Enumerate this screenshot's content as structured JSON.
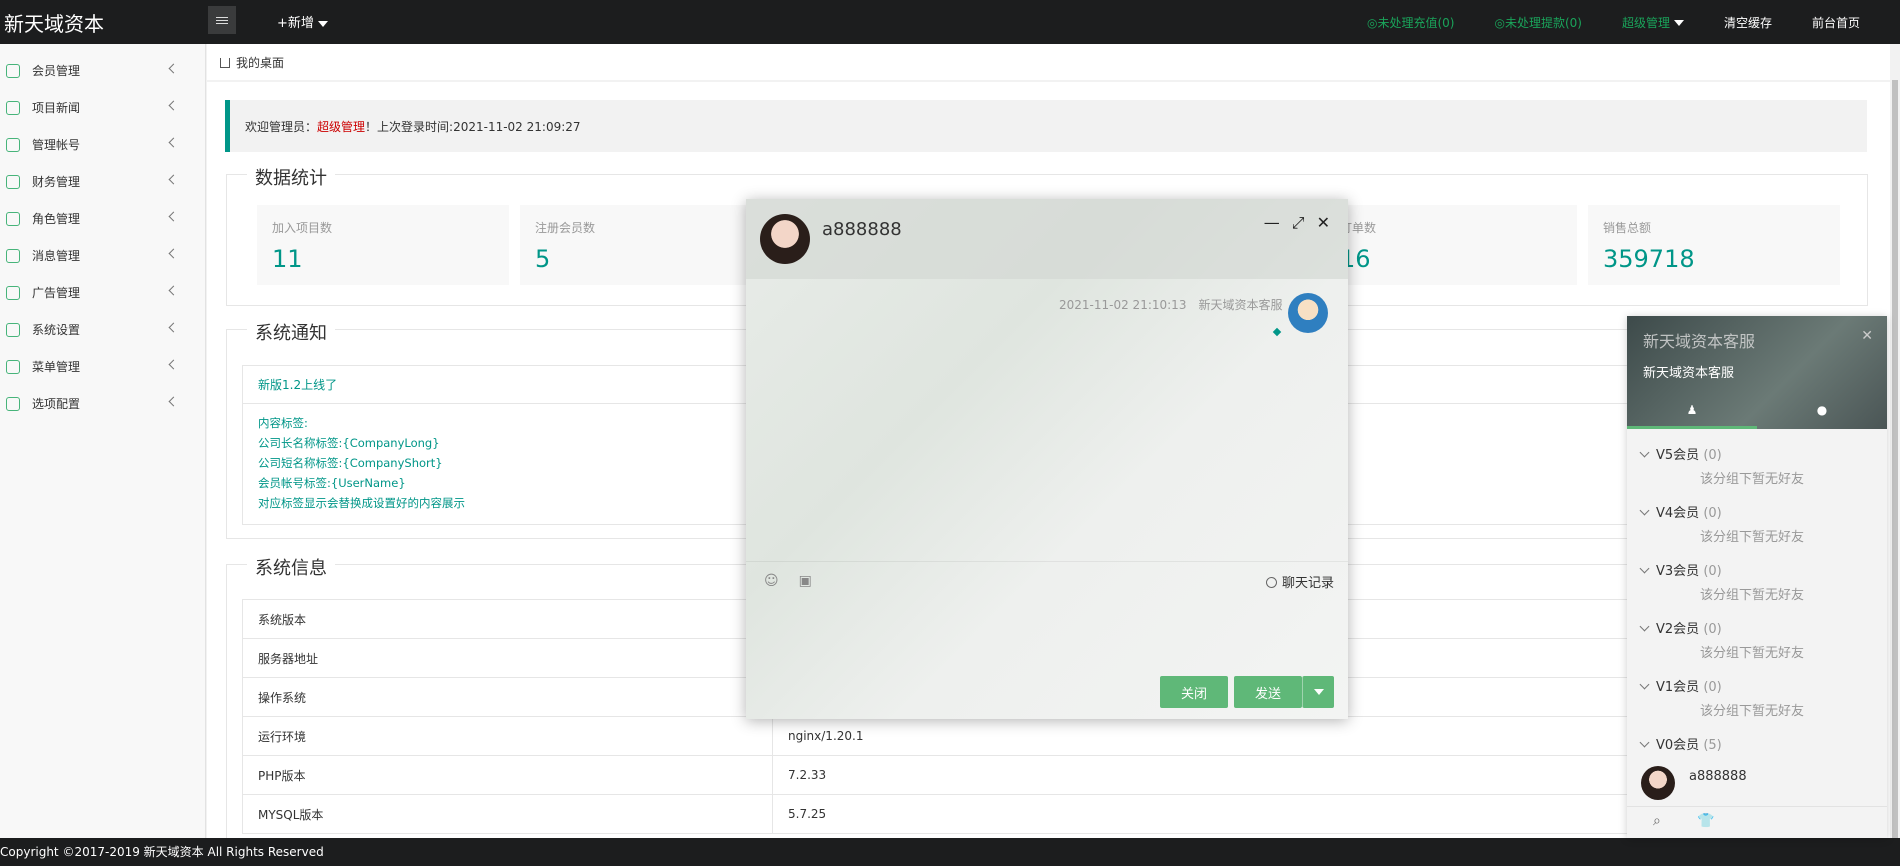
{
  "header": {
    "brand": "新天域资本",
    "add_label": "+新增",
    "pending_recharge": "◎未处理充值(0)",
    "pending_withdraw": "◎未处理提款(0)",
    "super_admin": "超级管理",
    "clear_cache": "清空缓存",
    "frontend_home": "前台首页"
  },
  "sidebar": {
    "items": [
      {
        "label": "会员管理"
      },
      {
        "label": "项目新闻"
      },
      {
        "label": "管理帐号"
      },
      {
        "label": "财务管理"
      },
      {
        "label": "角色管理"
      },
      {
        "label": "消息管理"
      },
      {
        "label": "广告管理"
      },
      {
        "label": "系统设置"
      },
      {
        "label": "菜单管理"
      },
      {
        "label": "选项配置"
      }
    ]
  },
  "breadcrumb": {
    "label": "我的桌面"
  },
  "welcome": {
    "prefix": "欢迎管理员：",
    "role": "超级管理",
    "suffix": "！上次登录时间:2021-11-02 21:09:27"
  },
  "stats": {
    "legend": "数据统计",
    "cards": [
      {
        "label": "加入项目数",
        "value": "11"
      },
      {
        "label": "注册会员数",
        "value": "5"
      },
      {
        "label": "订单数",
        "value": "16"
      },
      {
        "label": "销售总额",
        "value": "359718"
      }
    ]
  },
  "notice": {
    "legend": "系统通知",
    "title": "新版1.2上线了",
    "lines": [
      "内容标签:",
      "公司长名称标签:{CompanyLong}",
      "公司短名称标签:{CompanyShort}",
      "会员帐号标签:{UserName}",
      "对应标签显示会替换成设置好的内容展示"
    ]
  },
  "sysinfo": {
    "legend": "系统信息",
    "rows": [
      {
        "k": "系统版本",
        "v": ""
      },
      {
        "k": "服务器地址",
        "v": ""
      },
      {
        "k": "操作系统",
        "v": ""
      },
      {
        "k": "运行环境",
        "v": "nginx/1.20.1"
      },
      {
        "k": "PHP版本",
        "v": "7.2.33"
      },
      {
        "k": "MYSQL版本",
        "v": "5.7.25"
      }
    ]
  },
  "footer": {
    "text": "Copyright ©2017-2019 新天域资本 All Rights Reserved"
  },
  "chat": {
    "name": "a888888",
    "msg_time": "2021-11-02 21:10:13",
    "msg_sender": "新天域资本客服",
    "history_label": "聊天记录",
    "close_label": "关闭",
    "send_label": "发送"
  },
  "panel": {
    "title": "新天域资本客服",
    "subtitle": "新天域资本客服",
    "groups": [
      {
        "name": "V5会员",
        "count": "(0)",
        "empty": "该分组下暂无好友"
      },
      {
        "name": "V4会员",
        "count": "(0)",
        "empty": "该分组下暂无好友"
      },
      {
        "name": "V3会员",
        "count": "(0)",
        "empty": "该分组下暂无好友"
      },
      {
        "name": "V2会员",
        "count": "(0)",
        "empty": "该分组下暂无好友"
      },
      {
        "name": "V1会员",
        "count": "(0)",
        "empty": "该分组下暂无好友"
      },
      {
        "name": "V0会员",
        "count": "(5)",
        "empty": ""
      }
    ],
    "friend_name": "a888888"
  },
  "colors": {
    "accent": "#009688",
    "button": "#5fb878",
    "header": "#1c1d1e",
    "alert": "#cc0000"
  }
}
